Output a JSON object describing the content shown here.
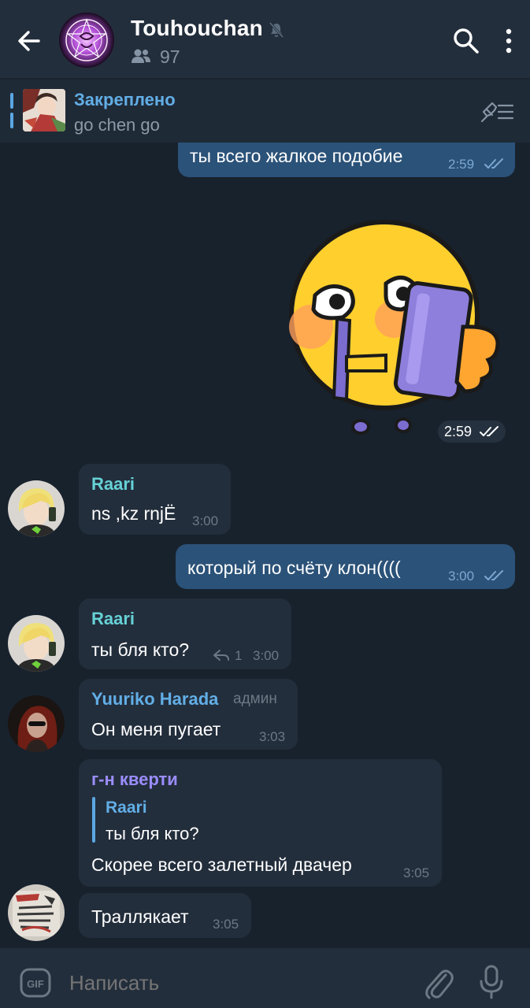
{
  "header": {
    "title": "Touhouchan",
    "members_count": "97",
    "icons": [
      "arrow-left-icon",
      "mute-icon",
      "people-icon",
      "search-icon",
      "more-vertical-icon"
    ]
  },
  "pinned": {
    "title": "Закреплено",
    "text": "go chen go"
  },
  "messages": [
    {
      "type": "out",
      "text": "ты всего жалкое подобие",
      "time": "2:59",
      "status": "read"
    },
    {
      "type": "sticker",
      "time": "2:59",
      "status": "read"
    },
    {
      "type": "in",
      "sender": "Raari",
      "sender_color": "#66d1d6",
      "text": "ns ,kz rnjЁ",
      "time": "3:00"
    },
    {
      "type": "out",
      "text": "который по счёту клон((((",
      "time": "3:00",
      "status": "read"
    },
    {
      "type": "in",
      "sender": "Raari",
      "sender_color": "#66d1d6",
      "text": "ты бля кто?",
      "replies": "1",
      "time": "3:00"
    },
    {
      "type": "in",
      "sender": "Yuuriko Harada",
      "sender_color": "#62aee6",
      "role": "админ",
      "text": "Он меня пугает",
      "time": "3:03"
    },
    {
      "type": "in",
      "sender": "г-н кверти",
      "sender_color": "#9b8dff",
      "reply_to": {
        "sender": "Raari",
        "text": "ты бля кто?"
      },
      "text": "Скорее всего залетный двачер",
      "time": "3:05"
    },
    {
      "type": "in",
      "text": "Траллякает",
      "time": "3:05"
    }
  ],
  "input": {
    "placeholder": "Написать"
  },
  "colors": {
    "background": "#18222d",
    "header": "#232e3c",
    "bubble_out": "#2b5278",
    "bubble_in": "#232e3c",
    "accent": "#62aee6"
  }
}
